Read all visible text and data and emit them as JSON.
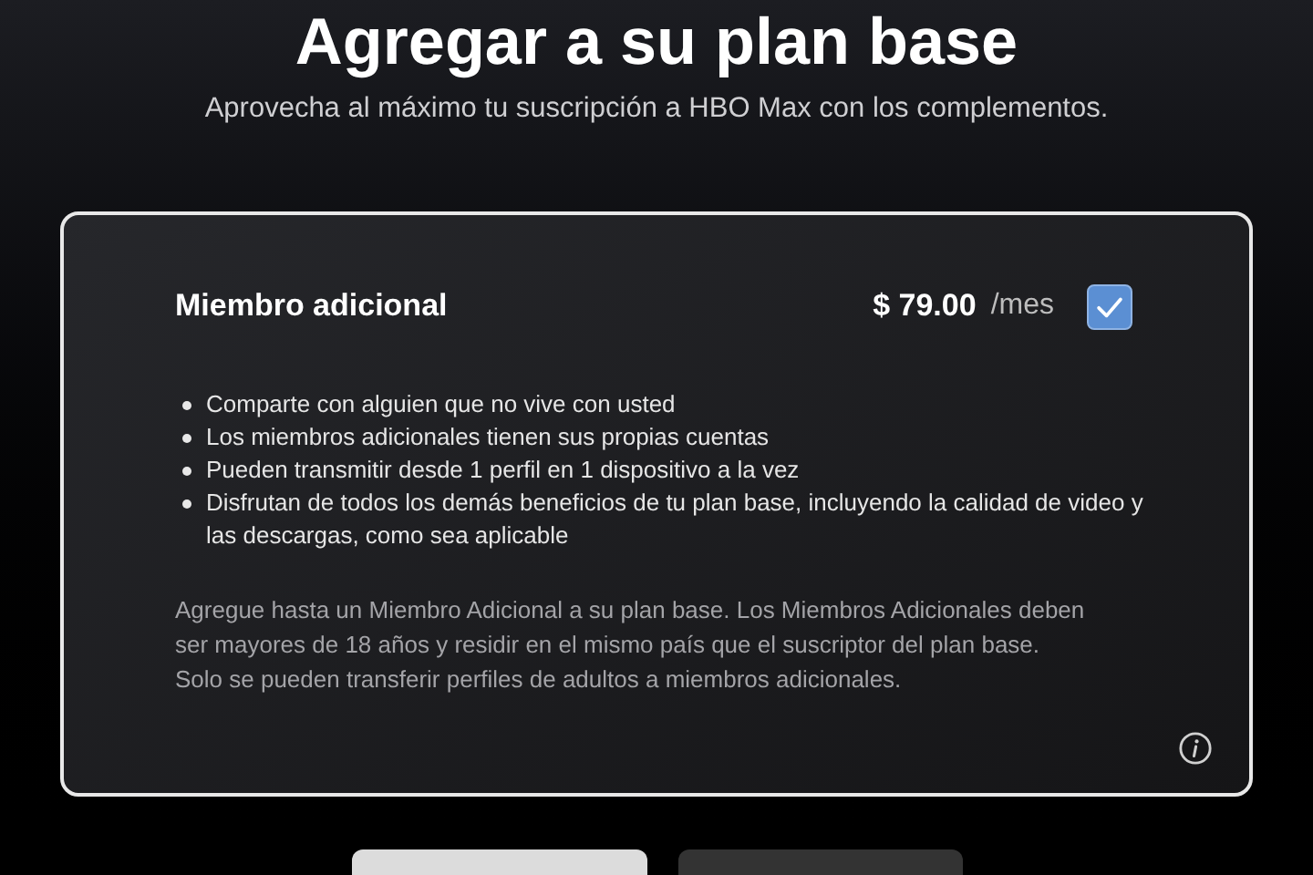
{
  "title": "Agregar a su plan base",
  "subtitle": "Aprovecha al máximo tu suscripción a HBO Max con los complementos.",
  "addon": {
    "name": "Miembro adicional",
    "price": "$ 79.00",
    "period": "/mes",
    "checked": true,
    "benefits": [
      "Comparte con alguien que no vive con usted",
      "Los miembros adicionales tienen sus propias cuentas",
      "Pueden transmitir desde 1 perfil en 1 dispositivo a la vez",
      "Disfrutan de todos los demás beneficios de tu plan base, incluyendo la calidad de video y las descargas, como sea aplicable"
    ],
    "note": "Agregue hasta un Miembro Adicional a su plan base. Los Miembros Adicionales deben ser mayores de 18 años y residir en el mismo país que el suscriptor del plan base. Solo se pueden transferir perfiles de adultos a miembros adicionales."
  },
  "buttons": [
    {
      "kind": "primary"
    },
    {
      "kind": "secondary"
    }
  ]
}
